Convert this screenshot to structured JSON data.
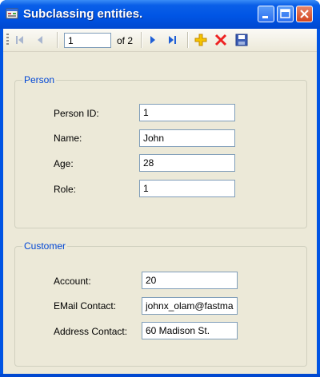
{
  "window": {
    "title": "Subclassing entities."
  },
  "navigator": {
    "position": "1",
    "count_label": "of 2",
    "icons": [
      "move-first-icon",
      "move-previous-icon",
      "move-next-icon",
      "move-last-icon",
      "add-new-icon",
      "delete-icon",
      "save-icon"
    ]
  },
  "person": {
    "legend": "Person",
    "fields": [
      {
        "label": "Person ID:",
        "value": "1"
      },
      {
        "label": "Name:",
        "value": "John"
      },
      {
        "label": "Age:",
        "value": "28"
      },
      {
        "label": "Role:",
        "value": "1"
      }
    ]
  },
  "customer": {
    "legend": "Customer",
    "fields": [
      {
        "label": "Account:",
        "value": "20"
      },
      {
        "label": "EMail Contact:",
        "value": "johnx_olam@fastma"
      },
      {
        "label": "Address Contact:",
        "value": "60 Madison St."
      }
    ]
  },
  "colors": {
    "titlebar": "#0055e5",
    "client": "#ece9d8",
    "legend": "#0046d5",
    "field_border": "#7f9db9"
  }
}
